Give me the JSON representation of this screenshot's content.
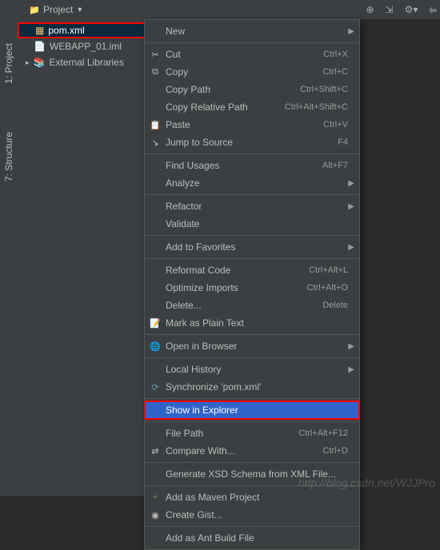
{
  "toolbar": {
    "project_tab": "Project"
  },
  "side_tabs": {
    "project": "1: Project",
    "structure": "7: Structure"
  },
  "tree": {
    "pom": "pom.xml",
    "iml": "WEBAPP_01.iml",
    "ext": "External Libraries"
  },
  "menu": {
    "new": "New",
    "cut": "Cut",
    "cut_sc": "Ctrl+X",
    "copy": "Copy",
    "copy_sc": "Ctrl+C",
    "copy_path": "Copy Path",
    "copy_path_sc": "Ctrl+Shift+C",
    "copy_rel": "Copy Relative Path",
    "copy_rel_sc": "Ctrl+Alt+Shift+C",
    "paste": "Paste",
    "paste_sc": "Ctrl+V",
    "jump": "Jump to Source",
    "jump_sc": "F4",
    "find_usages": "Find Usages",
    "find_usages_sc": "Alt+F7",
    "analyze": "Analyze",
    "refactor": "Refactor",
    "validate": "Validate",
    "add_fav": "Add to Favorites",
    "reformat": "Reformat Code",
    "reformat_sc": "Ctrl+Alt+L",
    "opt_imports": "Optimize Imports",
    "opt_imports_sc": "Ctrl+Alt+O",
    "delete": "Delete...",
    "delete_sc": "Delete",
    "plain_text": "Mark as Plain Text",
    "open_browser": "Open in Browser",
    "local_hist": "Local History",
    "sync": "Synchronize 'pom.xml'",
    "show_explorer": "Show in Explorer",
    "file_path": "File Path",
    "file_path_sc": "Ctrl+Alt+F12",
    "compare": "Compare With...",
    "compare_sc": "Ctrl+D",
    "gen_xsd": "Generate XSD Schema from XML File...",
    "add_maven": "Add as Maven Project",
    "create_gist": "Create Gist...",
    "add_ant": "Add as Ant Build File"
  },
  "watermark": "http://blog.csdn.net/WJJPro"
}
